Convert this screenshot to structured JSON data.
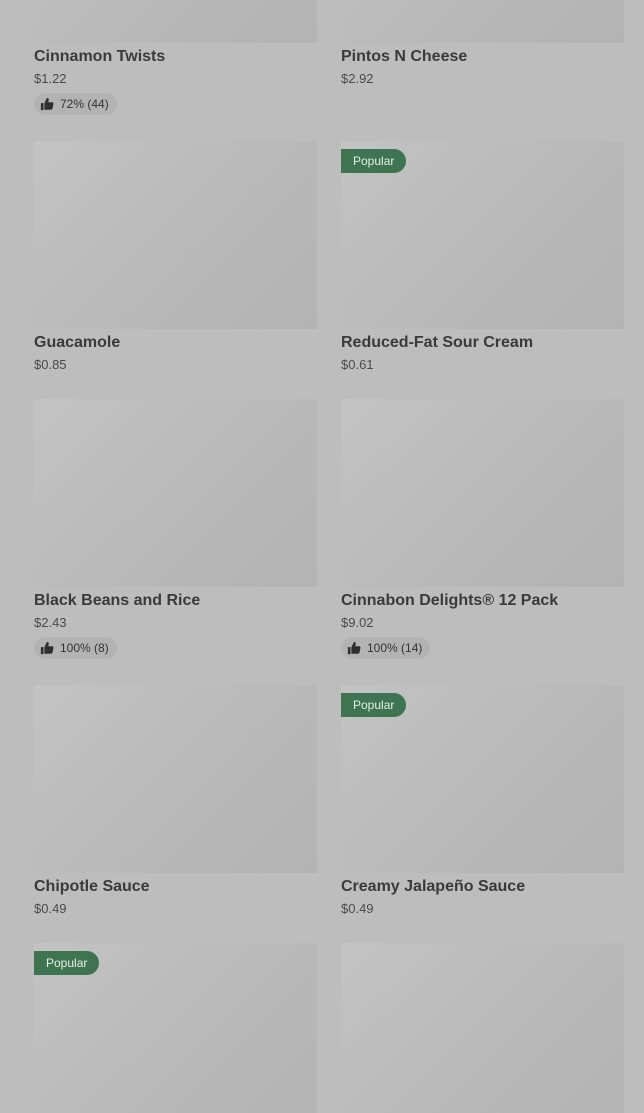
{
  "items": [
    {
      "name": "Cinnamon Twists",
      "price": "$1.22",
      "rating": "72% (44)"
    },
    {
      "name": "Pintos N Cheese",
      "price": "$2.92"
    },
    {
      "name": "Guacamole",
      "price": "$0.85"
    },
    {
      "name": "Reduced-Fat Sour Cream",
      "price": "$0.61",
      "badge": "Popular"
    },
    {
      "name": "Black Beans and Rice",
      "price": "$2.43",
      "rating": "100% (8)"
    },
    {
      "name": "Cinnabon Delights® 12 Pack",
      "price": "$9.02",
      "rating": "100% (14)"
    },
    {
      "name": "Chipotle Sauce",
      "price": "$0.49"
    },
    {
      "name": "Creamy Jalapeño Sauce",
      "price": "$0.49",
      "badge": "Popular"
    },
    {
      "badge": "Popular"
    },
    {}
  ],
  "colors": {
    "background": "#bdbdbd",
    "popular_badge": "#3e7550"
  },
  "icons": {
    "rating": "thumbs-up-icon"
  }
}
